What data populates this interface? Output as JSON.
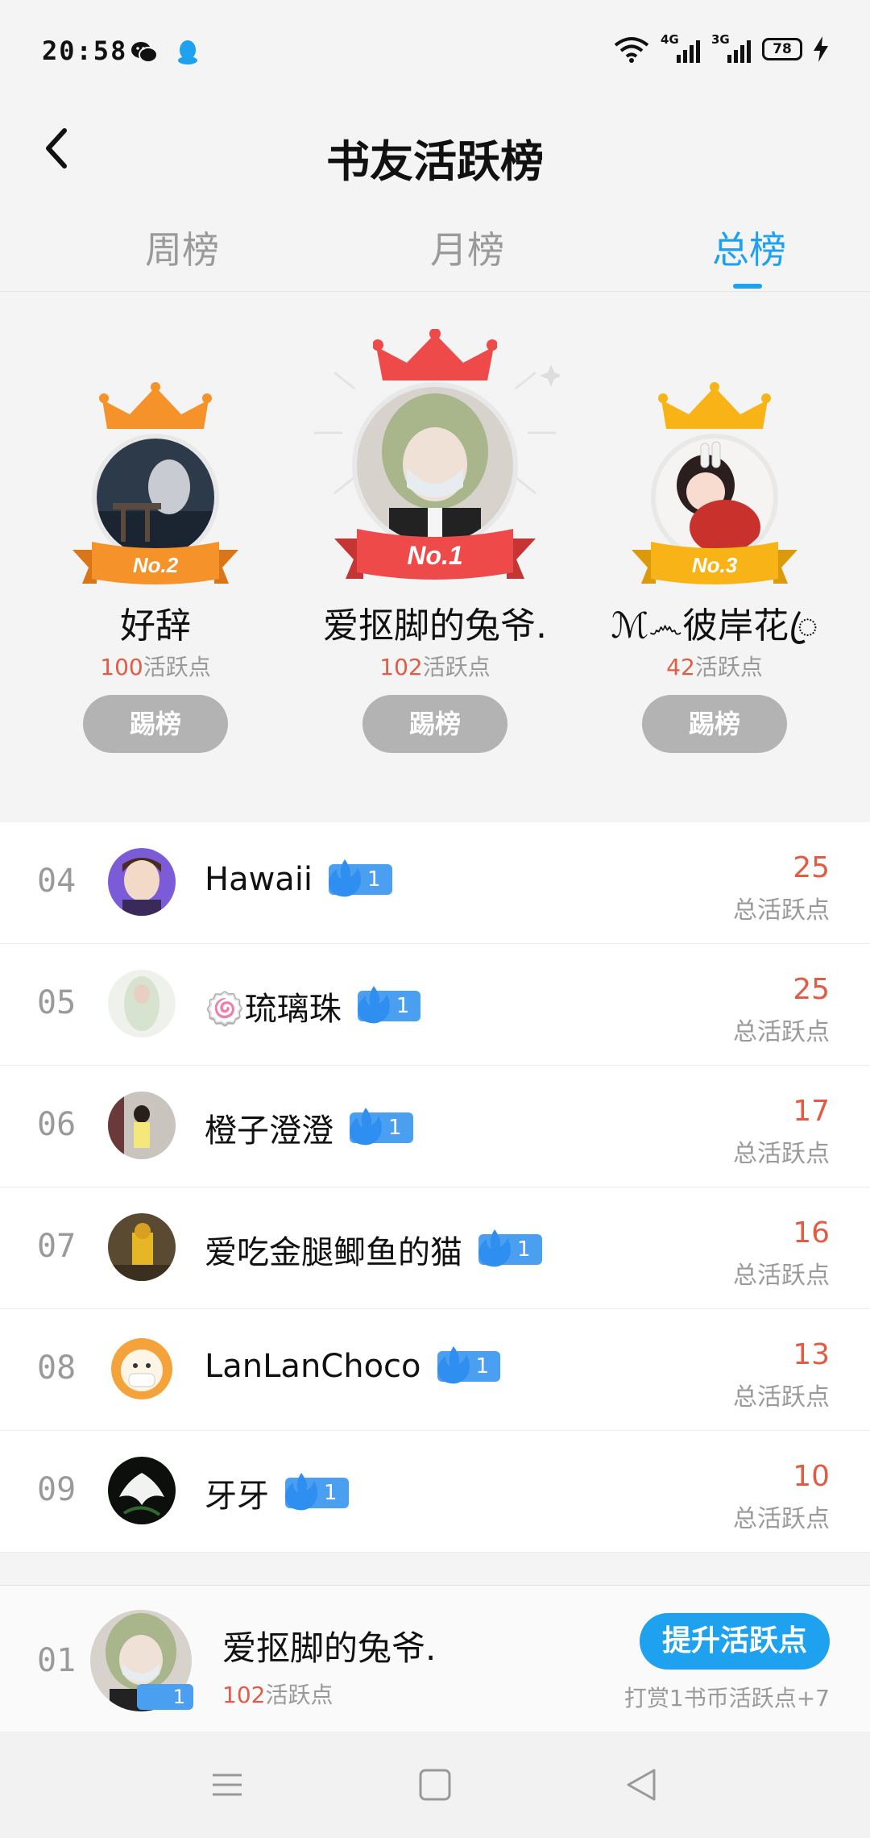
{
  "status_bar": {
    "time": "20:58",
    "network_1": "4G",
    "network_2": "3G",
    "battery": "78",
    "icons": [
      "wechat-icon",
      "qq-icon",
      "wifi-icon",
      "signal-icon",
      "battery-icon",
      "charging-icon"
    ]
  },
  "header": {
    "title": "书友活跃榜",
    "back_icon": "back-chevron-icon"
  },
  "tabs": [
    {
      "label": "周榜",
      "active": false
    },
    {
      "label": "月榜",
      "active": false
    },
    {
      "label": "总榜",
      "active": true
    }
  ],
  "podium": [
    {
      "rank_badge": "No.2",
      "name": "好辞",
      "points": "100",
      "points_label": "活跃点",
      "button": "踢榜",
      "crown_color": "#f5922a",
      "ribbon_color": "#f5922a"
    },
    {
      "rank_badge": "No.1",
      "name": "爱抠脚的兔爷.",
      "points": "102",
      "points_label": "活跃点",
      "button": "踢榜",
      "crown_color": "#ee4a4a",
      "ribbon_color": "#ee4a4a"
    },
    {
      "rank_badge": "No.3",
      "name": "ℳ෴彼岸花ꦿ",
      "points": "42",
      "points_label": "活跃点",
      "button": "踢榜",
      "crown_color": "#f8b417",
      "ribbon_color": "#f8b417"
    }
  ],
  "list": [
    {
      "rank": "04",
      "name": "Hawaii",
      "level": "1",
      "score": "25",
      "score_label": "总活跃点"
    },
    {
      "rank": "05",
      "name": "🍥琉璃珠",
      "level": "1",
      "score": "25",
      "score_label": "总活跃点"
    },
    {
      "rank": "06",
      "name": "橙子澄澄",
      "level": "1",
      "score": "17",
      "score_label": "总活跃点"
    },
    {
      "rank": "07",
      "name": "爱吃金腿鲫鱼的猫",
      "level": "1",
      "score": "16",
      "score_label": "总活跃点"
    },
    {
      "rank": "08",
      "name": "LanLanChoco",
      "level": "1",
      "score": "13",
      "score_label": "总活跃点"
    },
    {
      "rank": "09",
      "name": "牙牙",
      "level": "1",
      "score": "10",
      "score_label": "总活跃点"
    }
  ],
  "my_rank": {
    "rank": "01",
    "name": "爱抠脚的兔爷.",
    "level": "1",
    "points": "102",
    "points_label": "活跃点",
    "button": "提升活跃点",
    "hint": "打赏1书币活跃点+7"
  },
  "nav_bar": {
    "icons": [
      "menu-icon",
      "home-square-icon",
      "back-triangle-icon"
    ]
  },
  "colors": {
    "accent": "#1ea2ef",
    "score": "#e25c45",
    "badge": "#4a9ff0",
    "kick_button": "#b3b3b3"
  }
}
